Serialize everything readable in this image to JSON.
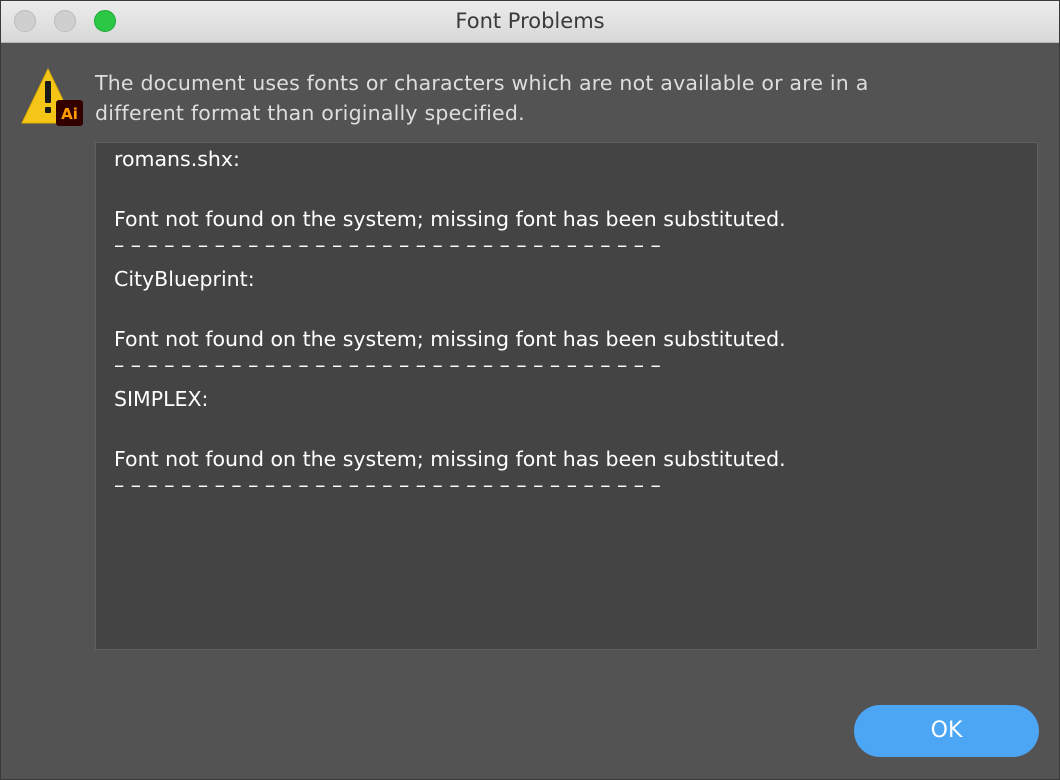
{
  "window": {
    "title": "Font Problems"
  },
  "alert": {
    "icon": "warning-illustrator-icon",
    "badge_text": "Ai",
    "message_line1": "The document uses fonts or characters which are not available or are in a",
    "message_line2": "different format than originally specified."
  },
  "report": {
    "lines": [
      "romans.shx:",
      "",
      "Font not found on the system; missing font has been substituted.",
      "– – – – – – – – – – – – – – – – – – – – – – – – – – – – – – – – –",
      "CityBlueprint:",
      "",
      "Font not found on the system; missing font has been substituted.",
      "– – – – – – – – – – – – – – – – – – – – – – – – – – – – – – – – –",
      "SIMPLEX:",
      "",
      "Font not found on the system; missing font has been substituted.",
      "– – – – – – – – – – – – – – – – – – – – – – – – – – – – – – – – –"
    ]
  },
  "buttons": {
    "ok_label": "OK"
  },
  "colors": {
    "background": "#535353",
    "text_area": "#444444",
    "accent_button": "#4ca6f4",
    "warning_yellow": "#f5c518",
    "ai_badge_bg": "#330000",
    "ai_badge_text": "#ff9a00"
  }
}
